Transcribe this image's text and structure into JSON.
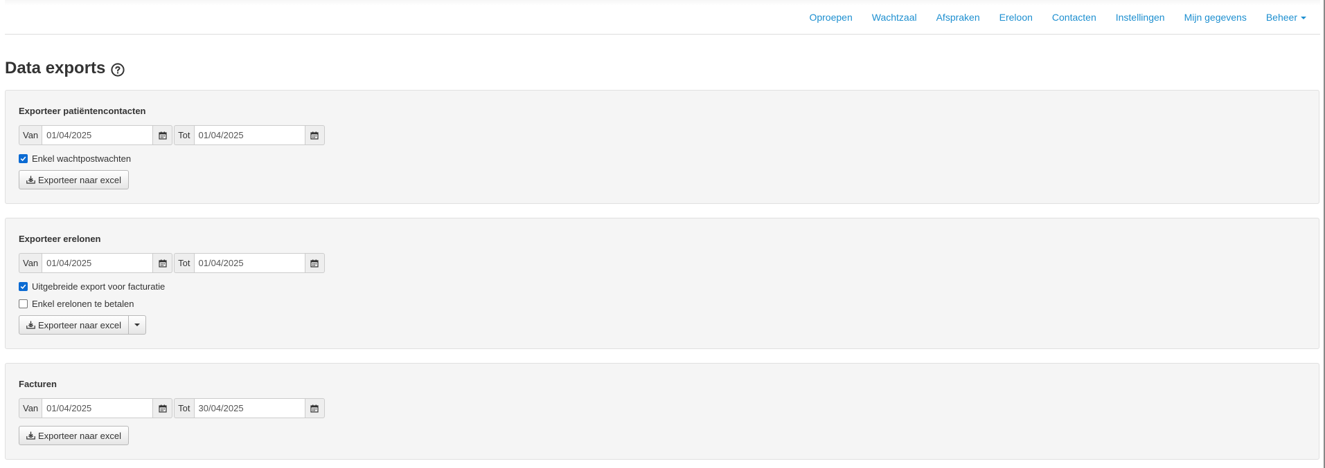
{
  "nav": {
    "items": [
      {
        "label": "Oproepen"
      },
      {
        "label": "Wachtzaal"
      },
      {
        "label": "Afspraken"
      },
      {
        "label": "Ereloon"
      },
      {
        "label": "Contacten"
      },
      {
        "label": "Instellingen"
      },
      {
        "label": "Mijn gegevens"
      },
      {
        "label": "Beheer"
      }
    ],
    "link_color": "#1d8fd0"
  },
  "page": {
    "title": "Data exports",
    "help_icon": "question-circle-icon"
  },
  "sections": [
    {
      "title": "Exporteer patiëntencontacten",
      "from_label": "Van",
      "from_value": "01/04/2025",
      "to_label": "Tot",
      "to_value": "01/04/2025",
      "checkboxes": [
        {
          "label": "Enkel wachtpostwachten",
          "checked": true
        }
      ],
      "export_label": "Exporteer naar excel"
    },
    {
      "title": "Exporteer erelonen",
      "from_label": "Van",
      "from_value": "01/04/2025",
      "to_label": "Tot",
      "to_value": "01/04/2025",
      "checkboxes": [
        {
          "label": "Uitgebreide export voor facturatie",
          "checked": true
        },
        {
          "label": "Enkel erelonen te betalen",
          "checked": false
        }
      ],
      "export_label": "Exporteer naar excel"
    },
    {
      "title": "Facturen",
      "from_label": "Van",
      "from_value": "01/04/2025",
      "to_label": "Tot",
      "to_value": "30/04/2025",
      "export_label": "Exporteer naar excel"
    }
  ],
  "colors": {
    "panel_bg": "#f5f5f5",
    "checkbox_checked": "#0b6bd3"
  }
}
